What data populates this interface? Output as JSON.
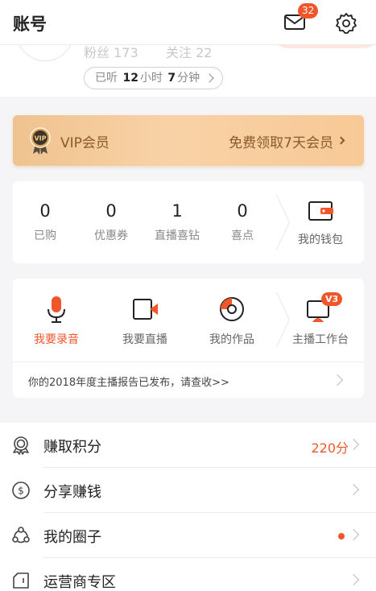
{
  "header": {
    "title": "账号",
    "mail_badge": "32"
  },
  "profile": {
    "fans": "粉丝 173",
    "following": "关注 22",
    "listened_prefix": "已听",
    "listened_hours": "12",
    "hours_unit": "小时",
    "listened_minutes": "7",
    "minutes_unit": "分钟"
  },
  "vip": {
    "label": "VIP会员",
    "promo": "免费领取7天会员",
    "icon_text": "VIP"
  },
  "wallet_stats": [
    {
      "num": "0",
      "label": "已购"
    },
    {
      "num": "0",
      "label": "优惠券"
    },
    {
      "num": "1",
      "label": "直播喜钻"
    },
    {
      "num": "0",
      "label": "喜点"
    }
  ],
  "wallet": {
    "label": "我的钱包"
  },
  "tools": [
    {
      "label": "我要录音",
      "icon": "microphone-icon"
    },
    {
      "label": "我要直播",
      "icon": "live-camera-icon"
    },
    {
      "label": "我的作品",
      "icon": "disc-icon"
    },
    {
      "label": "主播工作台",
      "icon": "monitor-icon",
      "badge": "V3"
    }
  ],
  "report": {
    "text": "你的2018年度主播报告已发布，请查收>>"
  },
  "list": [
    {
      "label": "赚取积分",
      "value": "220分",
      "icon": "medal-icon"
    },
    {
      "label": "分享赚钱",
      "icon": "dollar-coin-icon"
    },
    {
      "label": "我的圈子",
      "icon": "circle-network-icon",
      "dot": true
    },
    {
      "label": "运营商专区",
      "icon": "sim-card-icon"
    }
  ],
  "colors": {
    "accent": "#f1562b",
    "vip_text": "#8b5a28",
    "vip_bg": "#f8d2a6"
  }
}
